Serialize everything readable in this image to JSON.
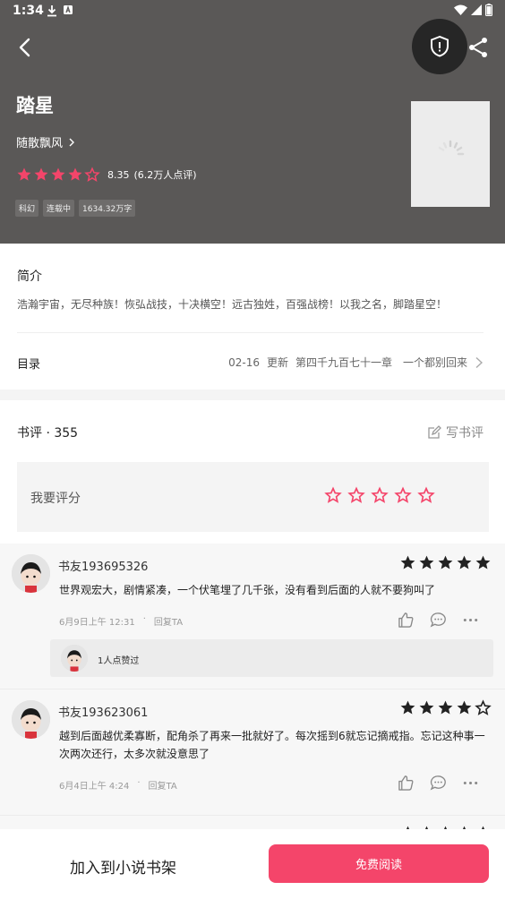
{
  "status_bar": {
    "time": "1:34"
  },
  "book": {
    "title": "踏星",
    "author": "随散飘风",
    "rating": "8.35",
    "rating_count": "(6.2万人点评)",
    "stars_filled": 4.5,
    "tags": [
      "科幻",
      "连载中",
      "1634.32万字"
    ]
  },
  "intro": {
    "label": "简介",
    "text": "浩瀚宇宙，无尽种族！恢弘战技，十决横空！远古独姓，百强战榜！以我之名，脚踏星空！"
  },
  "toc": {
    "label": "目录",
    "date": "02-16",
    "update": "更新",
    "chapter": "第四千九百七十一章　一个都别回来"
  },
  "reviews_section": {
    "header": "书评 · 355",
    "write_label": "写书评",
    "rate_label": "我要评分"
  },
  "reviews": [
    {
      "name": "书友193695326",
      "stars": 5,
      "text": "世界观宏大，剧情紧凑，一个伏笔埋了几千张，没有看到后面的人就不要狗叫了",
      "date": "6月9日上午 12:31",
      "dot": "·",
      "reply": "回复TA",
      "likes": "1人点赞过"
    },
    {
      "name": "书友193623061",
      "stars": 4,
      "text": "越到后面越优柔寡断，配角杀了再来一批就好了。每次摇到6就忘记摘戒指。忘记这种事一次两次还行，太多次就没意思了",
      "date": "6月4日上午 4:24",
      "dot": "·",
      "reply": "回复TA"
    }
  ],
  "bottom": {
    "add_shelf": "加入到小说书架",
    "read": "免费阅读"
  },
  "colors": {
    "header_bg": "#5a5857",
    "accent_pink": "#f4456a",
    "star_dark": "#222222"
  }
}
